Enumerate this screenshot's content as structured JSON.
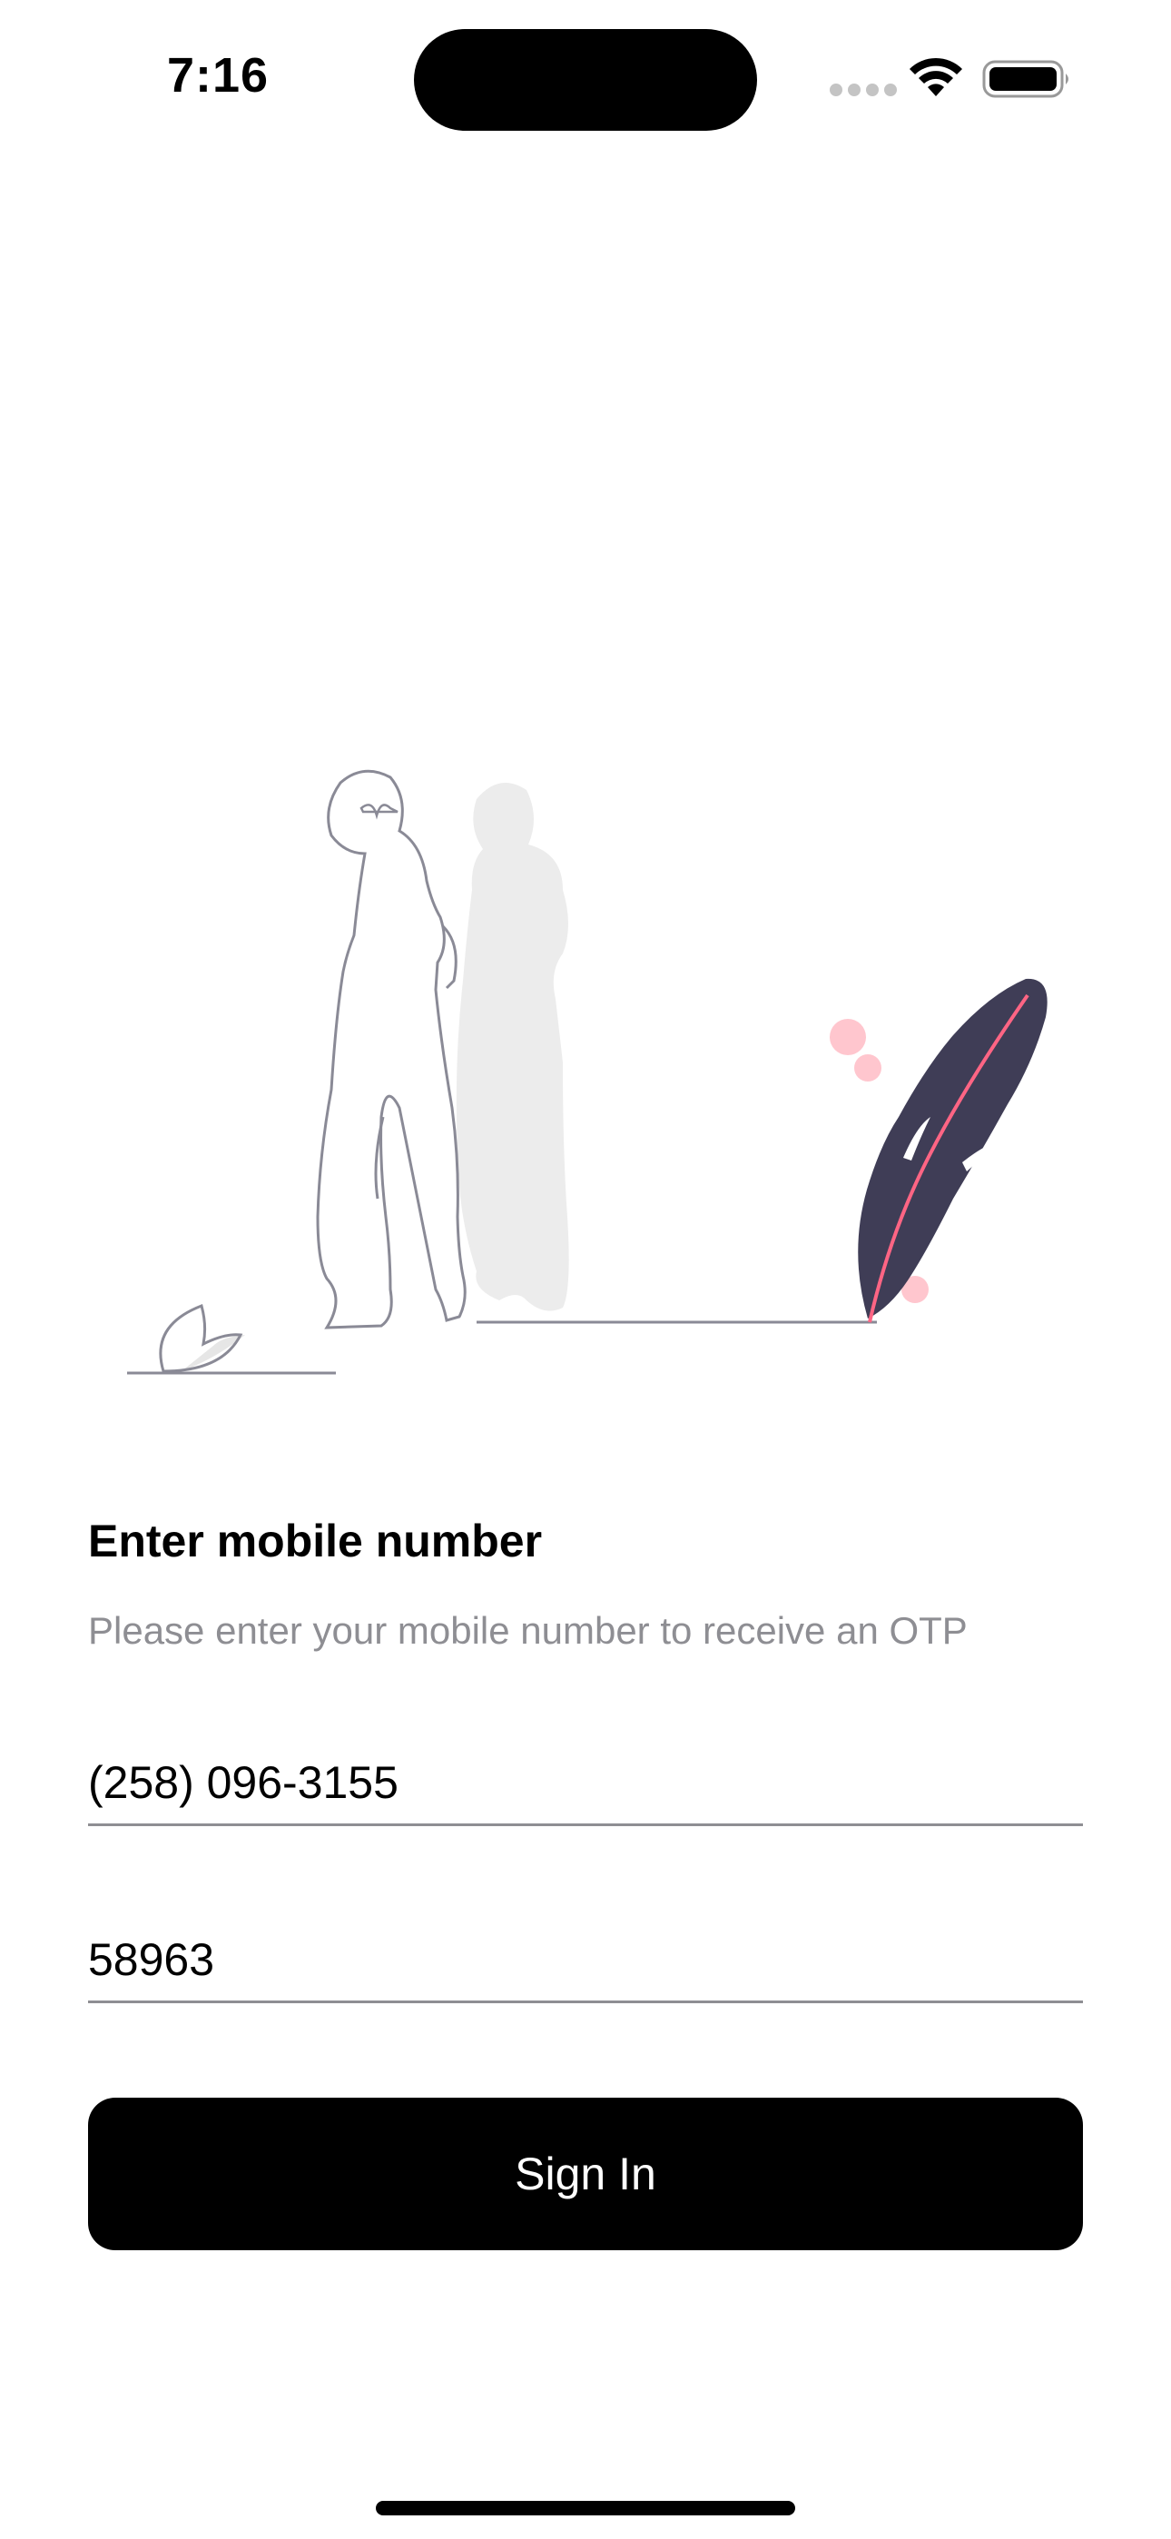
{
  "status_bar": {
    "time": "7:16"
  },
  "login": {
    "heading": "Enter mobile number",
    "subtext": "Please enter your mobile number to receive an OTP",
    "phone_value": "(258) 096-3155",
    "otp_value": "58963",
    "sign_in_label": "Sign In"
  },
  "colors": {
    "accent": "#000000",
    "secondary_text": "#8e8e93",
    "feather": "#3f3d56",
    "feather_accent": "#ff6584"
  }
}
